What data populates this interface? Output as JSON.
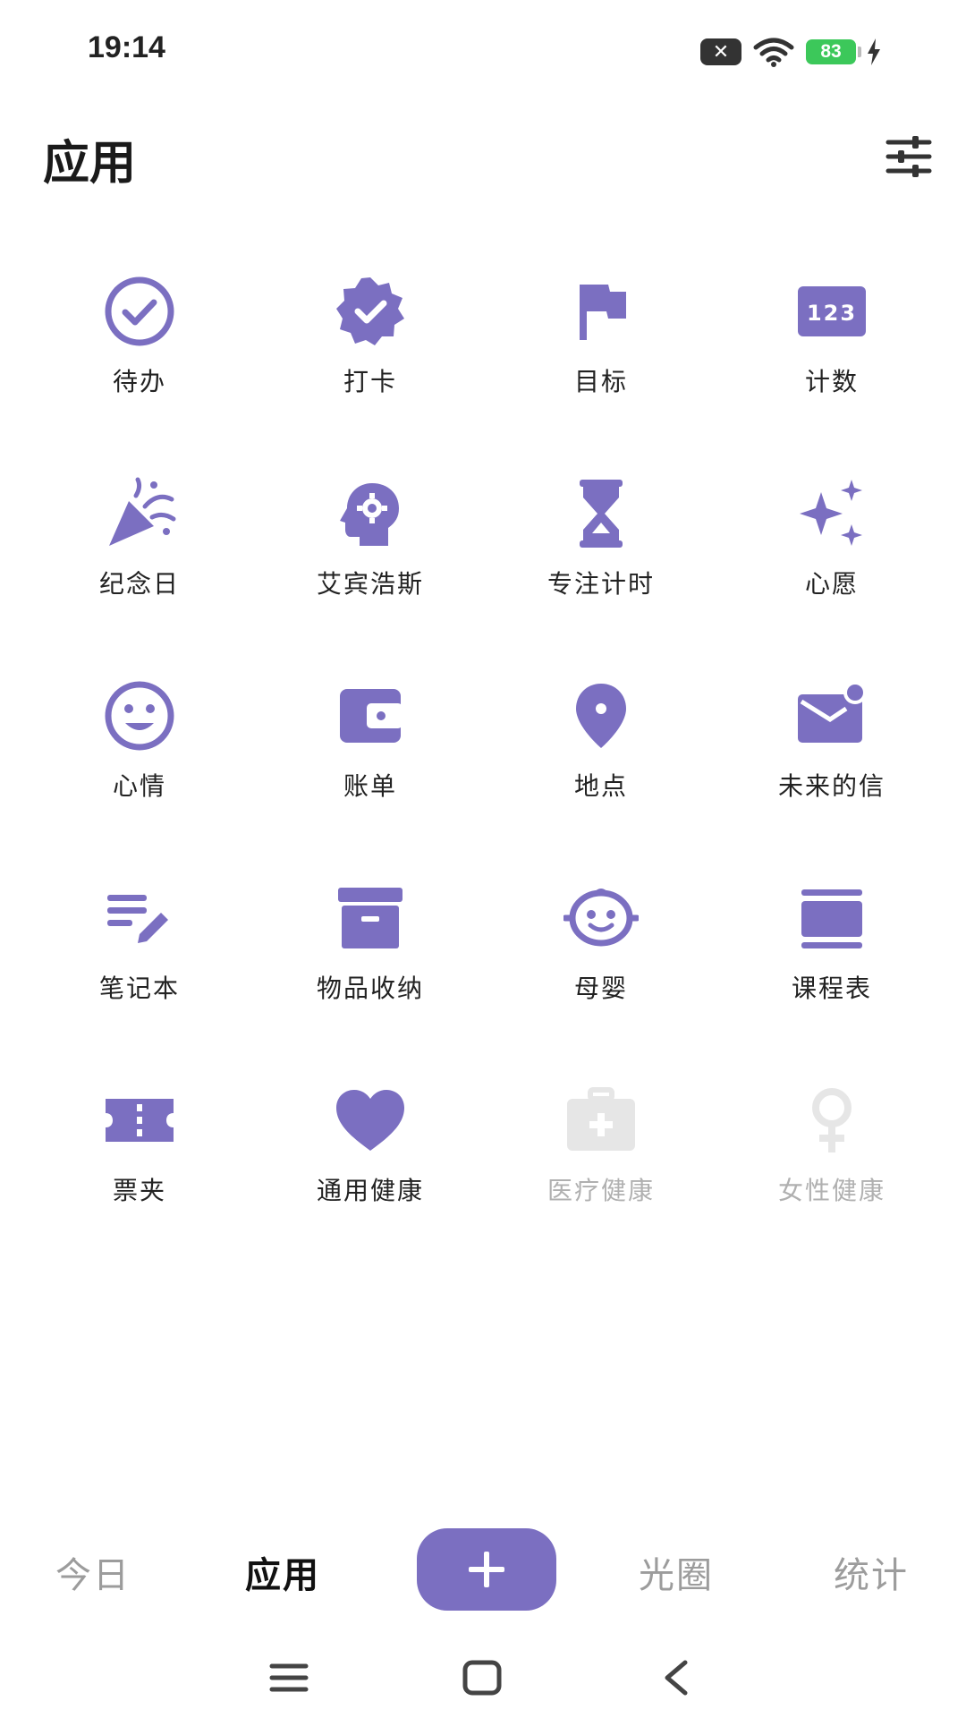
{
  "status": {
    "time": "19:14",
    "battery": "83"
  },
  "header": {
    "title": "应用"
  },
  "apps": [
    {
      "label": "待办",
      "icon": "check-circle-icon"
    },
    {
      "label": "打卡",
      "icon": "verified-badge-icon"
    },
    {
      "label": "目标",
      "icon": "flag-icon"
    },
    {
      "label": "计数",
      "icon": "counter-123-icon"
    },
    {
      "label": "纪念日",
      "icon": "party-popper-icon"
    },
    {
      "label": "艾宾浩斯",
      "icon": "brain-gear-icon"
    },
    {
      "label": "专注计时",
      "icon": "hourglass-icon"
    },
    {
      "label": "心愿",
      "icon": "sparkle-icon"
    },
    {
      "label": "心情",
      "icon": "smiley-icon"
    },
    {
      "label": "账单",
      "icon": "wallet-icon"
    },
    {
      "label": "地点",
      "icon": "location-pin-icon"
    },
    {
      "label": "未来的信",
      "icon": "mail-notification-icon"
    },
    {
      "label": "笔记本",
      "icon": "notes-edit-icon"
    },
    {
      "label": "物品收纳",
      "icon": "archive-box-icon"
    },
    {
      "label": "母婴",
      "icon": "baby-face-icon"
    },
    {
      "label": "课程表",
      "icon": "schedule-icon"
    },
    {
      "label": "票夹",
      "icon": "ticket-icon"
    },
    {
      "label": "通用健康",
      "icon": "heart-icon"
    },
    {
      "label": "医疗健康",
      "icon": "medical-kit-icon",
      "disabled": true
    },
    {
      "label": "女性健康",
      "icon": "female-icon",
      "disabled": true
    }
  ],
  "nav": {
    "tabs": [
      {
        "label": "今日",
        "active": false
      },
      {
        "label": "应用",
        "active": true
      },
      {
        "label": "光圈",
        "active": false
      },
      {
        "label": "统计",
        "active": false
      }
    ],
    "fab": "add-icon"
  },
  "colors": {
    "accent": "#7b6fc1",
    "disabled": "#e6e6e6"
  }
}
